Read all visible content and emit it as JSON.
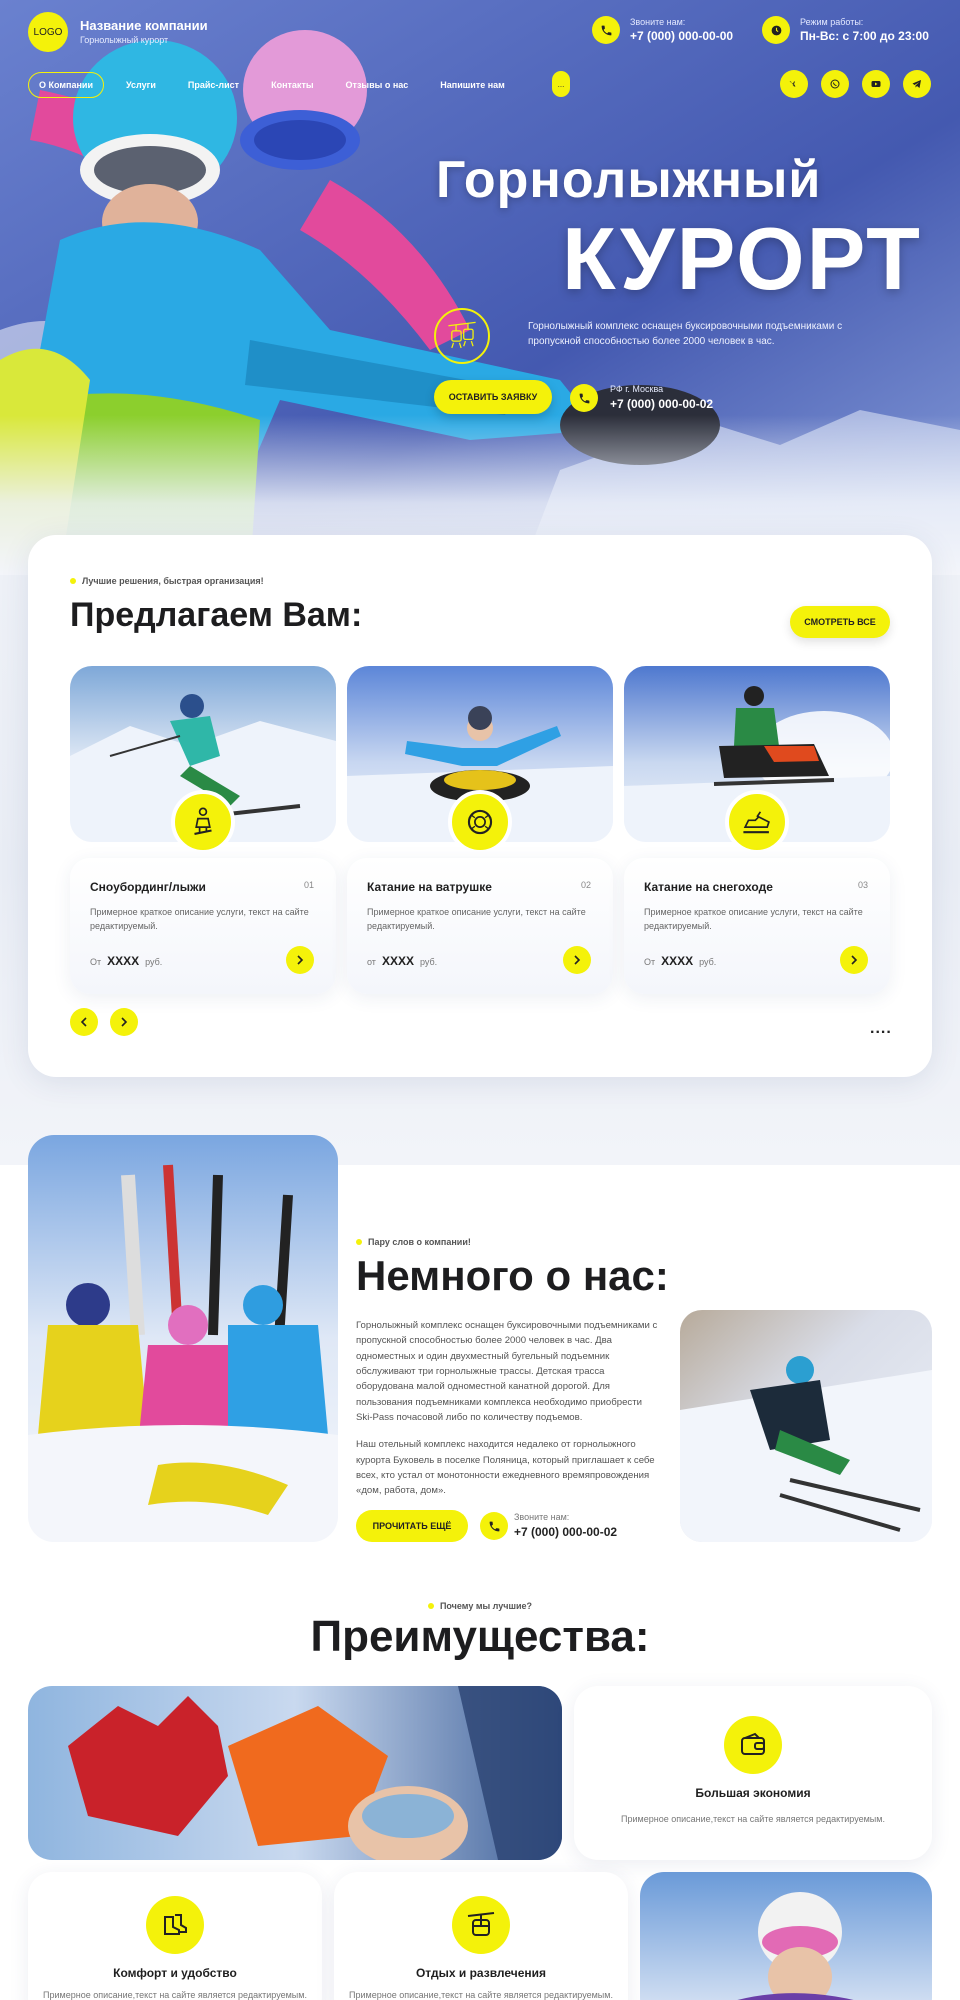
{
  "header": {
    "logo": "LOGO",
    "company_name": "Название компании",
    "company_sub": "Горнолыжный курорт",
    "phone_label": "Звоните нам:",
    "phone_value": "+7 (000) 000-00-00",
    "hours_label": "Режим работы:",
    "hours_value": "Пн-Вс: с 7:00 до 23:00",
    "nav": [
      "О Компании",
      "Услуги",
      "Прайс-лист",
      "Контакты",
      "Отзывы о нас",
      "Напишите нам"
    ],
    "nav_more": "...",
    "socials": [
      "vk-icon",
      "whatsapp-icon",
      "youtube-icon",
      "telegram-icon"
    ]
  },
  "hero": {
    "title_line1": "Горнолыжный",
    "title_line2": "КУРОРТ",
    "description": "Горнолыжный комплекс оснащен буксировочными подъемниками с пропускной способностью более 2000 человек в час.",
    "cta": "ОСТАВИТЬ ЗАЯВКУ",
    "phone_label": "РФ г. Москва",
    "phone_value": "+7 (000) 000-00-02"
  },
  "offers": {
    "eyebrow": "Лучшие решения, быстрая организация!",
    "title": "Предлагаем Вам:",
    "see_all": "СМОТРЕТЬ ВСЕ",
    "more": "....",
    "items": [
      {
        "name": "Сноубординг/лыжи",
        "num": "01",
        "desc": "Примерное краткое описание услуги, текст на сайте редактируемый.",
        "price_prefix": "От",
        "price": "XXXX",
        "price_unit": "руб."
      },
      {
        "name": "Катание на ватрушке",
        "num": "02",
        "desc": "Примерное краткое описание услуги, текст на сайте редактируемый.",
        "price_prefix": "от",
        "price": "XXXX",
        "price_unit": "руб."
      },
      {
        "name": "Катание на снегоходе",
        "num": "03",
        "desc": "Примерное краткое описание услуги, текст на сайте редактируемый.",
        "price_prefix": "От",
        "price": "XXXX",
        "price_unit": "руб."
      }
    ]
  },
  "about": {
    "eyebrow": "Пару слов о компании!",
    "title": "Немного о нас:",
    "paragraph1": "Горнолыжный комплекс оснащен буксировочными подъемниками с пропускной способностью более 2000 человек в час. Два одноместных и один двухместный бугельный подъемник обслуживают три горнолыжные трассы. Детская трасса оборудована малой одноместной канатной дорогой. Для пользования подъемниками комплекса необходимо приобрести Ski-Pass почасовой либо по количеству подъемов.",
    "paragraph2": "Наш отельный комплекс находится недалеко от горнолыжного курорта Буковель в поселке Поляница, который приглашает к себе всех, кто устал от монотонности ежедневного времяпровождения «дом, работа, дом».",
    "read_more": "ПРОЧИТАТЬ ЕЩЁ",
    "phone_label": "Звоните нам:",
    "phone_value": "+7 (000) 000-00-02"
  },
  "advantages": {
    "eyebrow": "Почему мы лучшие?",
    "title": "Преимущества:",
    "items": [
      {
        "name": "Большая экономия",
        "desc": "Примерное описание,текст на сайте является редактируемым."
      },
      {
        "name": "Комфорт и удобство",
        "desc": "Примерное описание,текст на сайте является редактируемым."
      },
      {
        "name": "Отдых и развлечения",
        "desc": "Примерное описание,текст на сайте является редактируемым."
      }
    ]
  },
  "colors": {
    "accent": "#f4f20a",
    "dark": "#1d1d1f",
    "hero_blue": "#4d63b8"
  }
}
